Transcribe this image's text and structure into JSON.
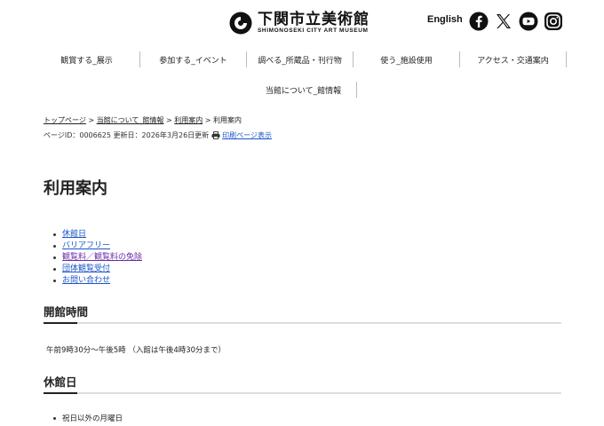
{
  "header": {
    "logo_main": "下関市立美術館",
    "logo_sub": "SHIMONOSEKI CITY ART MUSEUM",
    "lang_link": "English",
    "social": [
      "facebook-icon",
      "x-icon",
      "youtube-icon",
      "instagram-icon"
    ]
  },
  "nav": {
    "items": [
      {
        "label": "観賞する_展示"
      },
      {
        "label": "参加する_イベント"
      },
      {
        "label": "調べる_所蔵品・刊行物"
      },
      {
        "label": "使う_施設使用"
      },
      {
        "label": "アクセス・交通案内"
      }
    ],
    "second_row": "当館について_館情報"
  },
  "breadcrumb": {
    "home": "トップページ",
    "sep": " > ",
    "about": "当館について_館情報",
    "guide": "利用案内",
    "current": "利用案内"
  },
  "meta": {
    "page_id": "ページID：0006625 更新日：2026年3月26日更新",
    "print_link": "印刷ページ表示"
  },
  "page_title": "利用案内",
  "toc": [
    {
      "label": "休館日"
    },
    {
      "label": "バリアフリー"
    },
    {
      "label": "観覧料／観覧料の免除"
    },
    {
      "label": "団体観覧受付"
    },
    {
      "label": "お問い合わせ"
    }
  ],
  "sections": {
    "hours_title": "開館時間",
    "hours_text": "午前9時30分〜午後5時 （入館は午後4時30分まで）",
    "closed_title": "休館日",
    "closed_item": "祝日以外の月曜日"
  },
  "colors": {
    "link": "#1a55c9",
    "visited_link": "#6a2aa8",
    "text": "#222222"
  }
}
